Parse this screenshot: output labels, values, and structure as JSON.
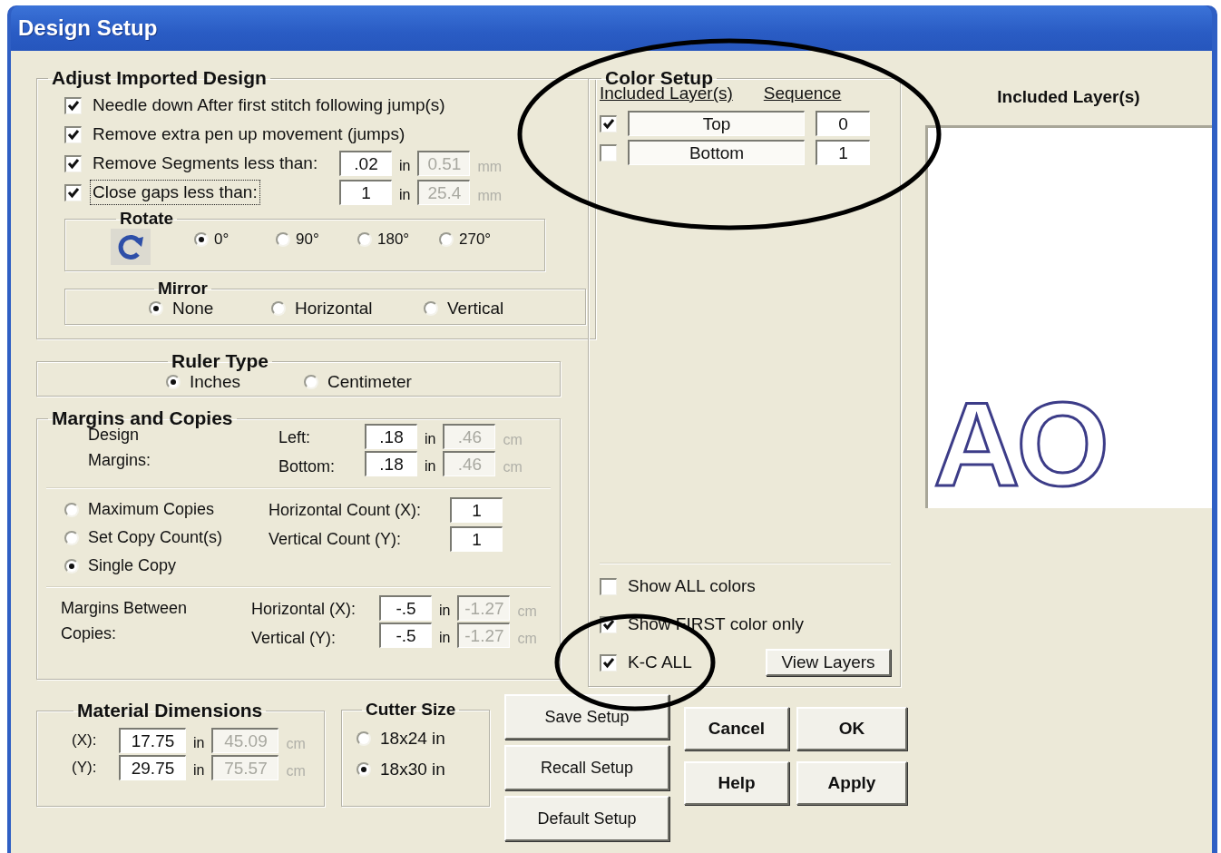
{
  "window": {
    "title": "Design Setup"
  },
  "adjust": {
    "title": "Adjust Imported Design",
    "options": [
      {
        "label": "Needle down After first stitch following jump(s)",
        "checked": true,
        "focused": false
      },
      {
        "label": "Remove extra pen up movement (jumps)",
        "checked": true,
        "focused": false
      },
      {
        "label": "Remove Segments less than:",
        "checked": true,
        "focused": false,
        "value": ".02",
        "unit": "in",
        "converted": "0.51",
        "converted_unit": "mm"
      },
      {
        "label": "Close gaps less than:",
        "checked": true,
        "focused": true,
        "value": "1",
        "unit": "in",
        "converted": "25.4",
        "converted_unit": "mm"
      }
    ]
  },
  "rotate": {
    "title": "Rotate",
    "options": [
      {
        "label": "0°",
        "selected": true
      },
      {
        "label": "90°",
        "selected": false
      },
      {
        "label": "180°",
        "selected": false
      },
      {
        "label": "270°",
        "selected": false
      }
    ]
  },
  "mirror": {
    "title": "Mirror",
    "options": [
      {
        "label": "None",
        "selected": true
      },
      {
        "label": "Horizontal",
        "selected": false
      },
      {
        "label": "Vertical",
        "selected": false
      }
    ]
  },
  "ruler": {
    "title": "Ruler Type",
    "options": [
      {
        "label": "Inches",
        "selected": true
      },
      {
        "label": "Centimeter",
        "selected": false
      }
    ]
  },
  "margins": {
    "title": "Margins and Copies",
    "design_label": "Design Margins:",
    "design_rows": [
      {
        "label": "Left:",
        "value": ".18",
        "unit": "in",
        "converted": ".46",
        "converted_unit": "cm"
      },
      {
        "label": "Bottom:",
        "value": ".18",
        "unit": "in",
        "converted": ".46",
        "converted_unit": "cm"
      }
    ],
    "copy_modes": [
      {
        "label": "Maximum Copies",
        "selected": false
      },
      {
        "label": "Set Copy Count(s)",
        "selected": false
      },
      {
        "label": "Single Copy",
        "selected": true
      }
    ],
    "counts": [
      {
        "label": "Horizontal Count (X):",
        "value": "1"
      },
      {
        "label": "Vertical Count (Y):",
        "value": "1"
      }
    ],
    "between_label": "Margins Between Copies:",
    "between_rows": [
      {
        "label": "Horizontal (X):",
        "value": "-.5",
        "unit": "in",
        "converted": "-1.27",
        "converted_unit": "cm"
      },
      {
        "label": "Vertical (Y):",
        "value": "-.5",
        "unit": "in",
        "converted": "-1.27",
        "converted_unit": "cm"
      }
    ]
  },
  "color_setup": {
    "title": "Color Setup",
    "circled": true,
    "columns": [
      "Included Layer(s)",
      "Sequence"
    ],
    "layers": [
      {
        "name": "Top",
        "sequence": "0",
        "checked": true
      },
      {
        "name": "Bottom",
        "sequence": "1",
        "checked": false
      }
    ],
    "options": [
      {
        "label": "Show ALL colors",
        "checked": false,
        "circled": false
      },
      {
        "label": "Show FIRST color only",
        "checked": true,
        "circled": false
      },
      {
        "label": "K-C ALL",
        "checked": true,
        "circled": true
      }
    ],
    "view_button": "View Layers"
  },
  "preview": {
    "title": "Included Layer(s)",
    "design_text": "AO"
  },
  "material": {
    "title": "Material Dimensions",
    "rows": [
      {
        "label": "(X):",
        "value": "17.75",
        "unit": "in",
        "converted": "45.09",
        "converted_unit": "cm"
      },
      {
        "label": "(Y):",
        "value": "29.75",
        "unit": "in",
        "converted": "75.57",
        "converted_unit": "cm"
      }
    ]
  },
  "cutter": {
    "title": "Cutter Size",
    "options": [
      {
        "label": "18x24 in",
        "selected": false
      },
      {
        "label": "18x30 in",
        "selected": true
      }
    ]
  },
  "setup_buttons": [
    "Save Setup",
    "Recall Setup",
    "Default Setup"
  ],
  "dialog_buttons": [
    "Cancel",
    "OK",
    "Help",
    "Apply"
  ]
}
